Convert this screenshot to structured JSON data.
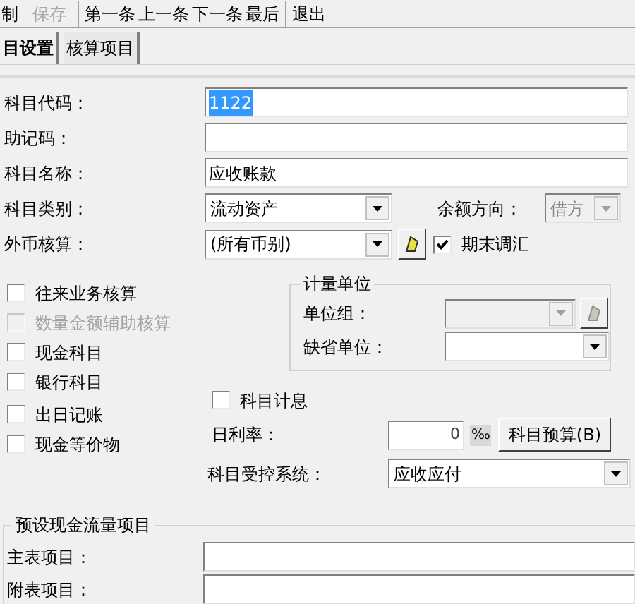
{
  "toolbar": [
    {
      "label": "制",
      "disabled": false,
      "separator_after": false
    },
    {
      "label": "保存",
      "disabled": true,
      "separator_after": true
    },
    {
      "label": "第一条",
      "disabled": false,
      "separator_after": false
    },
    {
      "label": "上一条",
      "disabled": false,
      "separator_after": false
    },
    {
      "label": "下一条",
      "disabled": false,
      "separator_after": false
    },
    {
      "label": "最后",
      "disabled": false,
      "separator_after": true
    },
    {
      "label": "退出",
      "disabled": false,
      "separator_after": false
    }
  ],
  "tabs": [
    {
      "label": "目设置",
      "selected": true
    },
    {
      "label": "核算项目",
      "selected": false
    }
  ],
  "fields": [
    {
      "label": "科目代码：",
      "value": "1122",
      "text_selected": true
    },
    {
      "label": "助记码："
    },
    {
      "label": "科目名称：",
      "value": "应收账款",
      "text_selected": false
    }
  ],
  "category": {
    "label": "科目类别：",
    "value": "流动资产"
  },
  "balance_direction": {
    "label": "余额方向：",
    "value": "借方",
    "disabled": true
  },
  "foreign_currency": {
    "label": "外币核算：",
    "value": "(所有币别)"
  },
  "period_end_adjust": {
    "label": "期末调汇",
    "checked": true
  },
  "options": [
    {
      "label": "往来业务核算",
      "checked": false,
      "disabled": false
    },
    {
      "label": "数量金额辅助核算",
      "checked": false,
      "disabled": true
    },
    {
      "label": "现金科目",
      "checked": false,
      "disabled": false
    },
    {
      "label": "银行科目",
      "checked": false,
      "disabled": false
    },
    {
      "label": "出日记账",
      "checked": false,
      "disabled": false
    },
    {
      "label": "现金等价物",
      "checked": false,
      "disabled": false
    }
  ],
  "measure_unit": {
    "title": "计量单位",
    "unit_group": {
      "label": "单位组：",
      "disabled": true
    },
    "default_unit": {
      "label": "缺省单位：",
      "disabled": false
    }
  },
  "interest": {
    "label": "科目计息",
    "checked": false
  },
  "daily_rate": {
    "label": "日利率：",
    "value": "0",
    "unit": "‰"
  },
  "budget_button": "科目预算(B)",
  "controlled_system": {
    "label": "科目受控系统：",
    "value": "应收应付"
  },
  "cash_flow": {
    "title": "预设现金流量项目",
    "fields": [
      {
        "label": "主表项目："
      },
      {
        "label": "附表项目："
      }
    ]
  }
}
